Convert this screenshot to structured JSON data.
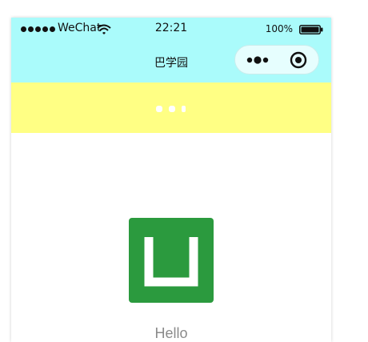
{
  "status_bar": {
    "carrier": "WeChat",
    "time": "22:21",
    "battery_percent": "100%",
    "signal_icon": "signal-dots-icon",
    "wifi_icon": "wifi-icon",
    "battery_icon": "battery-full-icon"
  },
  "nav_bar": {
    "title": "巴学园",
    "capsule": {
      "menu_icon": "more-dots-icon",
      "close_icon": "target-circle-icon"
    }
  },
  "loading": {
    "icon": "loading-dots-icon",
    "color": "#ffff84"
  },
  "content": {
    "logo_icon": "app-logo-icon",
    "greeting": "Hello"
  },
  "colors": {
    "nav_background": "#aafbfb",
    "loading_background": "#ffff84",
    "logo_green": "#2b9a3e",
    "greeting_text": "#8a8a8a"
  }
}
